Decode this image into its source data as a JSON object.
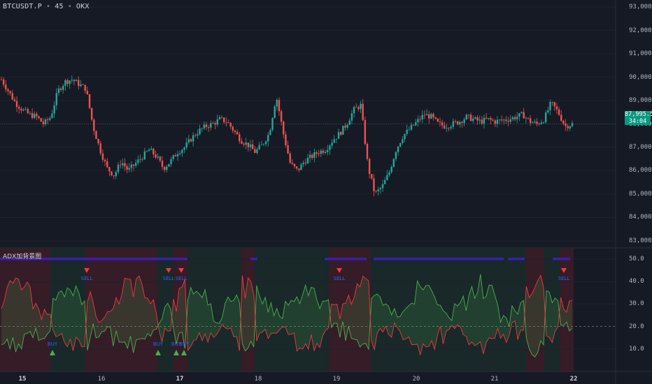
{
  "header": {
    "symbol": "BTCUSDT.P",
    "interval": "45",
    "exchange": "OKX",
    "separator": "•"
  },
  "price_axis": {
    "ticks": [
      "93,000.0",
      "92,000.0",
      "91,000.0",
      "90,000.0",
      "89,000.0",
      "88,000.0",
      "87,000.0",
      "86,000.0",
      "85,000.0",
      "84,000.0",
      "83,000.0"
    ],
    "current_price": "87,995.5",
    "countdown": "34:04",
    "badge_color": "#089981"
  },
  "indicator": {
    "title": "ADX加背景图",
    "ticks": [
      "50.0",
      "40.0",
      "30.0",
      "20.0",
      "10.0"
    ],
    "signals": [
      {
        "label": "SELL",
        "type": "sell"
      },
      {
        "label": "SELL",
        "type": "sell"
      },
      {
        "label": "SELL",
        "type": "sell"
      },
      {
        "label": "SELL",
        "type": "sell"
      },
      {
        "label": "SELL",
        "type": "sell"
      },
      {
        "label": "BUY",
        "type": "buy"
      },
      {
        "label": "BUY",
        "type": "buy"
      },
      {
        "label": "BUY",
        "type": "buy"
      },
      {
        "label": "BUY",
        "type": "buy"
      }
    ]
  },
  "time_axis": {
    "ticks": [
      "15",
      "16",
      "17",
      "18",
      "19",
      "20",
      "21",
      "22"
    ]
  },
  "colors": {
    "up": "#26a69a",
    "down": "#ef5350",
    "adx": "#3b1fb0",
    "plus_di": "#4caf50",
    "minus_di": "#f23645",
    "background": "#161a25"
  },
  "chart_data": {
    "type": "candlestick",
    "price_range": [
      82700,
      93300
    ],
    "close_path": [
      89900,
      89400,
      88900,
      88600,
      88400,
      88300,
      88000,
      88300,
      89400,
      89800,
      89900,
      89700,
      89500,
      87900,
      86900,
      86100,
      85800,
      86400,
      86000,
      86300,
      86600,
      86900,
      86600,
      86100,
      86400,
      86800,
      87000,
      87400,
      87700,
      87900,
      88000,
      88200,
      88100,
      87700,
      87300,
      87100,
      86800,
      87100,
      87600,
      89200,
      87600,
      86300,
      86000,
      86400,
      86600,
      86800,
      86900,
      87300,
      87600,
      88000,
      88600,
      88800,
      86200,
      85000,
      85300,
      85900,
      86900,
      87500,
      87800,
      88100,
      88400,
      88300,
      88000,
      87900,
      88000,
      88100,
      88300,
      88200,
      88100,
      88200,
      88100,
      88150,
      88200,
      88300,
      88400,
      88100,
      88000,
      88200,
      88900,
      88500,
      87900,
      87995
    ],
    "adx_range": [
      0,
      55
    ],
    "adx_level": 20,
    "adx_bands": [
      [
        0,
        268
      ],
      [
        358,
        368
      ],
      [
        464,
        524
      ],
      [
        534,
        720
      ],
      [
        726,
        750
      ],
      [
        790,
        815
      ]
    ]
  }
}
